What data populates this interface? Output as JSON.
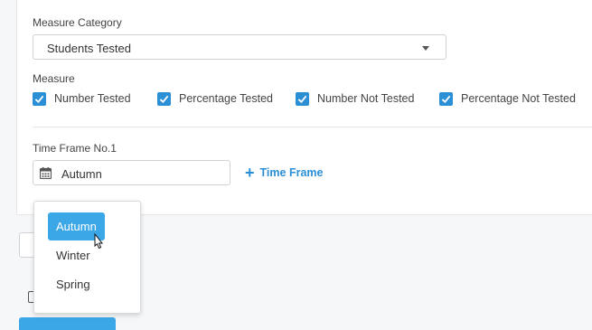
{
  "measure_category": {
    "label": "Measure Category",
    "selected": "Students Tested"
  },
  "measure": {
    "label": "Measure",
    "options": [
      {
        "label": "Number Tested",
        "checked": true
      },
      {
        "label": "Percentage Tested",
        "checked": true
      },
      {
        "label": "Number Not Tested",
        "checked": true
      },
      {
        "label": "Percentage Not Tested",
        "checked": true
      }
    ]
  },
  "time_frame": {
    "label": "Time Frame No.1",
    "value": "Autumn",
    "add_label": "Time Frame",
    "options": [
      "Autumn",
      "Winter",
      "Spring"
    ],
    "selected_index": 0
  },
  "colors": {
    "accent": "#2b8fd6",
    "selected_option": "#3ba7e6"
  },
  "icons": {
    "calendar": "calendar-icon",
    "plus": "plus-icon",
    "caret": "caret-down-icon",
    "check": "check-icon",
    "cursor": "mouse-pointer-icon"
  }
}
